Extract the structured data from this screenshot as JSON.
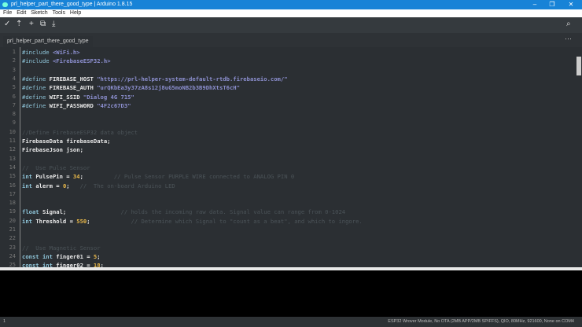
{
  "window": {
    "title": "prl_helper_part_there_good_type | Arduino 1.8.15"
  },
  "menu": [
    "File",
    "Edit",
    "Sketch",
    "Tools",
    "Help"
  ],
  "toolbar": {
    "verify": "✓",
    "upload": "⇡",
    "new": "+",
    "open": "⧉",
    "save": "⤓",
    "serial": "⌕",
    "tab_menu": "⋯"
  },
  "tab": {
    "label": "prl_helper_part_there_good_type"
  },
  "editor": {
    "lines": [
      [
        [
          "pp",
          "#include "
        ],
        [
          "str",
          "<WiFi.h>"
        ]
      ],
      [
        [
          "pp",
          "#include "
        ],
        [
          "str",
          "<FirebaseESP32.h>"
        ]
      ],
      [],
      [
        [
          "pp",
          "#define "
        ],
        [
          "t",
          "FIREBASE_HOST "
        ],
        [
          "str",
          "\"https://prl-helper-system-default-rtdb.firebaseio.com/\""
        ]
      ],
      [
        [
          "pp",
          "#define "
        ],
        [
          "t",
          "FIREBASE_AUTH "
        ],
        [
          "str",
          "\"urQKbEa3y37zA8s12j8uG5moNB2b3B9DhXtsT6cH\""
        ]
      ],
      [
        [
          "pp",
          "#define "
        ],
        [
          "t",
          "WIFI_SSID "
        ],
        [
          "str",
          "\"Dialog 4G 715\""
        ]
      ],
      [
        [
          "pp",
          "#define "
        ],
        [
          "t",
          "WIFI_PASSWORD "
        ],
        [
          "str",
          "\"4F2c67D3\""
        ]
      ],
      [],
      [],
      [
        [
          "cm",
          "//Define FirebaseESP32 data object"
        ]
      ],
      [
        [
          "t",
          "FirebaseData firebaseData;"
        ]
      ],
      [
        [
          "t",
          "FirebaseJson json;"
        ]
      ],
      [],
      [
        [
          "cm",
          "//  Use Pulse Sensor"
        ]
      ],
      [
        [
          "kw",
          "int "
        ],
        [
          "t",
          "PulsePin = "
        ],
        [
          "num",
          "34"
        ],
        [
          "t",
          ";"
        ],
        [
          "cm",
          "         // Pulse Sensor PURPLE WIRE connected to ANALOG PIN 0"
        ]
      ],
      [
        [
          "kw",
          "int "
        ],
        [
          "t",
          "alerm = "
        ],
        [
          "num",
          "0"
        ],
        [
          "t",
          ";"
        ],
        [
          "cm",
          "   //  The on-board Arduino LED"
        ]
      ],
      [],
      [],
      [
        [
          "kw",
          "float "
        ],
        [
          "t",
          "Signal;"
        ],
        [
          "cm",
          "                // holds the incoming raw data. Signal value can range from 0-1024"
        ]
      ],
      [
        [
          "kw",
          "int "
        ],
        [
          "t",
          "Threshold = "
        ],
        [
          "num",
          "550"
        ],
        [
          "t",
          ";"
        ],
        [
          "cm",
          "            // Determine which Signal to \"count as a beat\", and which to ingore."
        ]
      ],
      [],
      [],
      [
        [
          "cm",
          "//  Use Magnetic Sensor"
        ]
      ],
      [
        [
          "kw",
          "const int "
        ],
        [
          "t",
          "finger01 = "
        ],
        [
          "num",
          "5"
        ],
        [
          "t",
          ";"
        ]
      ],
      [
        [
          "kw",
          "const int "
        ],
        [
          "t",
          "finger02 = "
        ],
        [
          "num",
          "18"
        ],
        [
          "t",
          ";"
        ]
      ]
    ]
  },
  "status": {
    "line": "1",
    "board": "ESP32 Wrover Module, No OTA (2MB APP/2MB SPIFFS), QIO, 80MHz, 921600, None on COM4"
  }
}
